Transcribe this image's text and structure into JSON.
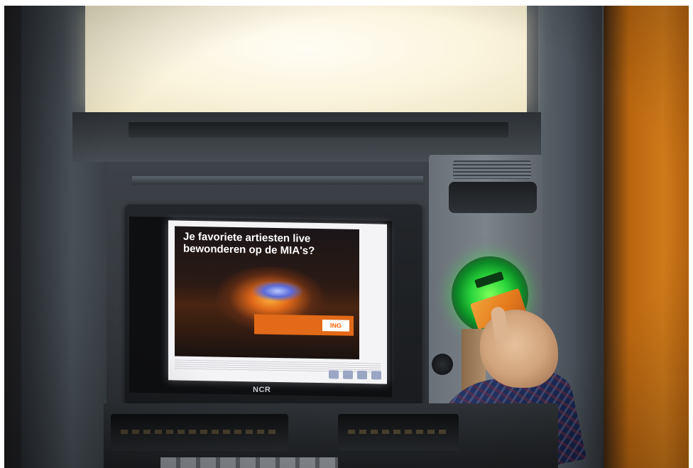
{
  "photo": {
    "subject": "ATM-machine"
  },
  "top_screen": {
    "color": "#fbf4dd"
  },
  "main_screen": {
    "headline": "Je favoriete artiesten live bewonderen op de MIA's?",
    "brand_logo": "ING",
    "brand_color": "#ff6200"
  },
  "manufacturer_logo": "NCR",
  "card_reader": {
    "light_color": "#29d43a"
  },
  "colors": {
    "wall": "#cf7a1a",
    "atm_body": "#3e4349",
    "card": "#e57a1c"
  }
}
